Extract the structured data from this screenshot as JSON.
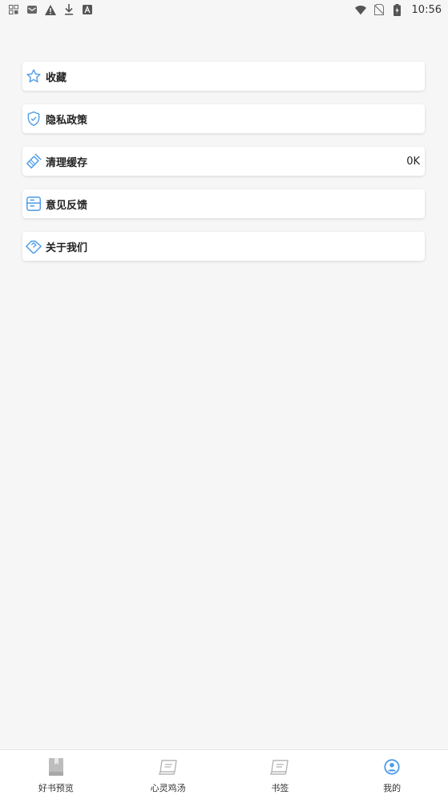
{
  "status_bar": {
    "time": "10:56",
    "left_icons": [
      "grid-icon",
      "mail-icon",
      "warning-icon",
      "download-icon",
      "font-icon"
    ],
    "right_icons": [
      "wifi-icon",
      "no-sim-icon",
      "battery-icon"
    ]
  },
  "menu": {
    "items": [
      {
        "label": "收藏",
        "icon": "star-icon",
        "value": ""
      },
      {
        "label": "隐私政策",
        "icon": "shield-check-icon",
        "value": ""
      },
      {
        "label": "清理缓存",
        "icon": "broom-icon",
        "value": "0K"
      },
      {
        "label": "意见反馈",
        "icon": "feedback-icon",
        "value": ""
      },
      {
        "label": "关于我们",
        "icon": "handshake-icon",
        "value": ""
      }
    ]
  },
  "bottom_nav": {
    "tabs": [
      {
        "label": "好书预览",
        "icon": "book-icon",
        "active": false
      },
      {
        "label": "心灵鸡汤",
        "icon": "reading-book-icon",
        "active": false
      },
      {
        "label": "书签",
        "icon": "bookmark-book-icon",
        "active": false
      },
      {
        "label": "我的",
        "icon": "profile-icon",
        "active": true
      }
    ]
  },
  "colors": {
    "accent": "#4a9be8",
    "background": "#f6f6f6",
    "card": "#ffffff",
    "nav_inactive_icon": "#b5b5b5"
  }
}
